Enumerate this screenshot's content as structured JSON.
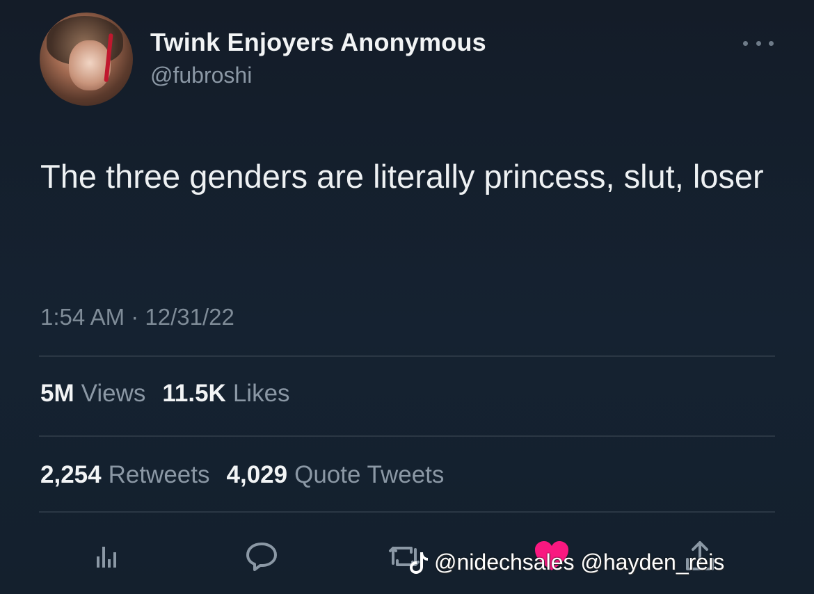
{
  "author": {
    "display_name": "Twink Enjoyers Anonymous",
    "handle": "@fubroshi",
    "avatar_icon": "avatar-photo"
  },
  "tweet": {
    "text": "The three genders are literally princess, slut, loser",
    "timestamp": "1:54 AM · 12/31/22"
  },
  "stats": {
    "views_count": "5M",
    "views_label": "Views",
    "likes_count": "11.5K",
    "likes_label": "Likes",
    "retweets_count": "2,254",
    "retweets_label": "Retweets",
    "quotes_count": "4,029",
    "quotes_label": "Quote Tweets"
  },
  "actions": {
    "icons": [
      "analytics-icon",
      "reply-icon",
      "retweet-icon",
      "like-icon",
      "share-icon"
    ],
    "like_color": "#f91880"
  },
  "watermark": {
    "text": "@nidechsales @hayden_reis"
  },
  "colors": {
    "background": "#15202b",
    "primary_text": "#f2f4f5",
    "secondary_text": "#8b98a5",
    "divider": "#2b3744"
  }
}
